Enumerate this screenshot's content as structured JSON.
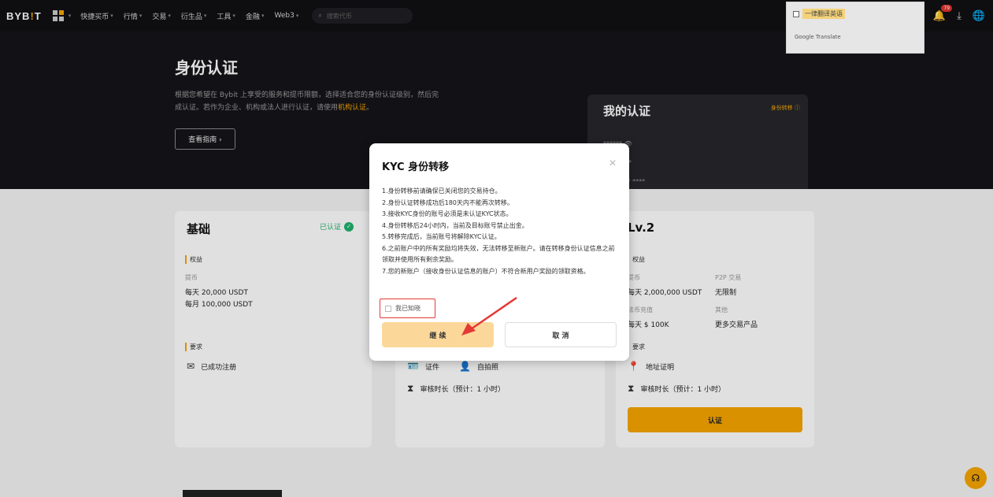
{
  "topbar": {
    "logo_main": "BYB",
    "logo_bang": "!",
    "logo_end": "T",
    "nav_items": [
      "快捷买币",
      "行情",
      "交易",
      "衍生品",
      "工具",
      "金融",
      "Web3"
    ],
    "search_placeholder": "搜索代币",
    "orders_label": "订单",
    "notification_count": "79"
  },
  "translate_popup": {
    "option_label": "一律翻译英语",
    "provider": "Google Translate"
  },
  "hero": {
    "title": "身份认证",
    "desc_line1": "根据您希望在 Bybit 上享受的服务和提币限额，选择适合您的身份认证级别，然后完",
    "desc_line2_prefix": "成认证。若作为企业、机构或法人进行认证，请使用",
    "desc_link": "机构认证",
    "desc_line2_suffix": "。",
    "guide_button": "查看指南 ›"
  },
  "my_card": {
    "title": "我的认证",
    "link": "身份转移 ⓘ",
    "line1": "****** 👁",
    "line2": "*********",
    "line3": "**** **** ****"
  },
  "basic_card": {
    "title": "基础",
    "status": "已认证",
    "section_benefits": "权益",
    "withdraw_label": "提币",
    "daily_limit": "每天 20,000 USDT",
    "monthly_limit": "每月 100,000 USDT",
    "section_requirements": "要求",
    "requirement": "已成功注册"
  },
  "lv1_card": {
    "req_id": "证件",
    "req_selfie": "自拍照",
    "review_time": "审核时长（预计：1 小时）"
  },
  "lv2_card": {
    "title": "Lv.2",
    "section_benefits": "权益",
    "withdraw_label": "提币",
    "daily_limit": "每天 2,000,000 USDT",
    "p2p_label": "P2P 交易",
    "p2p_value": "无限制",
    "fiat_label": "法币充值",
    "fiat_value": "每天 $ 100K",
    "other_label": "其他",
    "other_value": "更多交易产品",
    "section_requirements": "要求",
    "req_address": "地址证明",
    "review_time": "审核时长（预计：1 小时）",
    "verify_button": "认证"
  },
  "modal": {
    "title": "KYC 身份转移",
    "rules": [
      "1.身份转移前请确保已关闭您的交易持仓。",
      "2.身份认证转移成功后180天内不能再次转移。",
      "3.接收KYC身份的账号必须是未认证KYC状态。",
      "4.身份转移后24小时内，当前及目标账号禁止出金。",
      "5.转移完成后，当前账号将解除KYC认证。",
      "6.之前账户中的所有奖励均将失效，无法转移至新账户。请在转移身份认证信息之前领取并使用所有剩余奖励。",
      "7.您的新账户（接收身份认证信息的账户）不符合新用户奖励的领取资格。"
    ],
    "agree_label": "我已知晓",
    "continue_button": "继 续",
    "cancel_button": "取 消"
  }
}
